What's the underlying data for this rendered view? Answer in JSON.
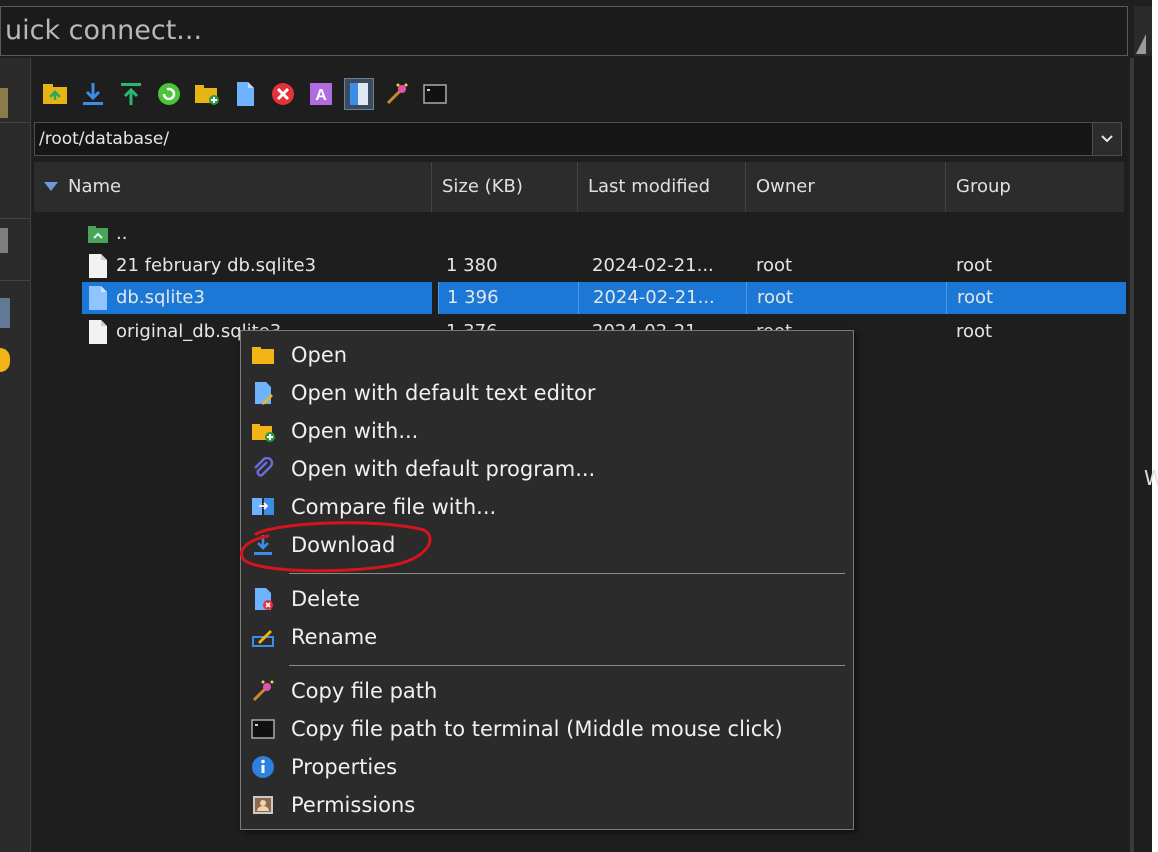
{
  "quick_connect": {
    "placeholder": "uick connect..."
  },
  "path": "/root/database/",
  "columns": {
    "name": "Name",
    "size": "Size (KB)",
    "modified": "Last modified",
    "owner": "Owner",
    "group": "Group"
  },
  "rows": [
    {
      "name": "..",
      "size": "",
      "modified": "",
      "owner": "",
      "group": "",
      "icon": "parent-folder-icon"
    },
    {
      "name": "21 february db.sqlite3",
      "size": "1 380",
      "modified": "2024-02-21...",
      "owner": "root",
      "group": "root",
      "icon": "file-icon"
    },
    {
      "name": "db.sqlite3",
      "size": "1 396",
      "modified": "2024-02-21...",
      "owner": "root",
      "group": "root",
      "icon": "file-icon",
      "selected": true
    },
    {
      "name": "original_db.sqlite3",
      "size": "1 376",
      "modified": "2024-02-21...",
      "owner": "root",
      "group": "root",
      "icon": "file-icon"
    }
  ],
  "context_menu": {
    "open": "Open",
    "open_text_editor": "Open with default text editor",
    "open_with": "Open with...",
    "open_default_program": "Open with default program...",
    "compare": "Compare file with...",
    "download": "Download",
    "delete": "Delete",
    "rename": "Rename",
    "copy_path": "Copy file path",
    "copy_path_terminal": "Copy file path to terminal (Middle mouse click)",
    "properties": "Properties",
    "permissions": "Permissions"
  },
  "right_panel_letter": "W",
  "colors": {
    "selection": "#1b78d6",
    "annotation": "#d4151c",
    "background": "#1e1e1e"
  }
}
